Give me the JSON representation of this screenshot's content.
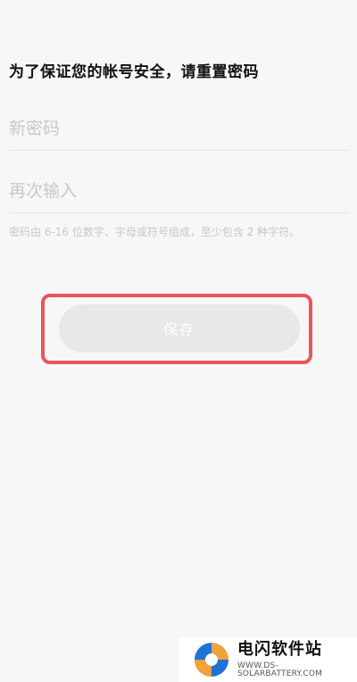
{
  "header": {
    "title": "为了保证您的帐号安全，请重置密码"
  },
  "form": {
    "new_password_placeholder": "新密码",
    "confirm_password_placeholder": "再次输入",
    "hint": "密码由 6-16 位数字、字母或符号组成，至少包含 2 种字符。",
    "save_label": "保存"
  },
  "watermark": {
    "title": "电闪软件站",
    "url": "WWW.DS-SOLARBATTERY.COM"
  },
  "colors": {
    "highlight": "#e8565e",
    "button_bg": "#e8e8e8",
    "logo_blue": "#1e73d8",
    "logo_orange": "#f2a23a"
  }
}
